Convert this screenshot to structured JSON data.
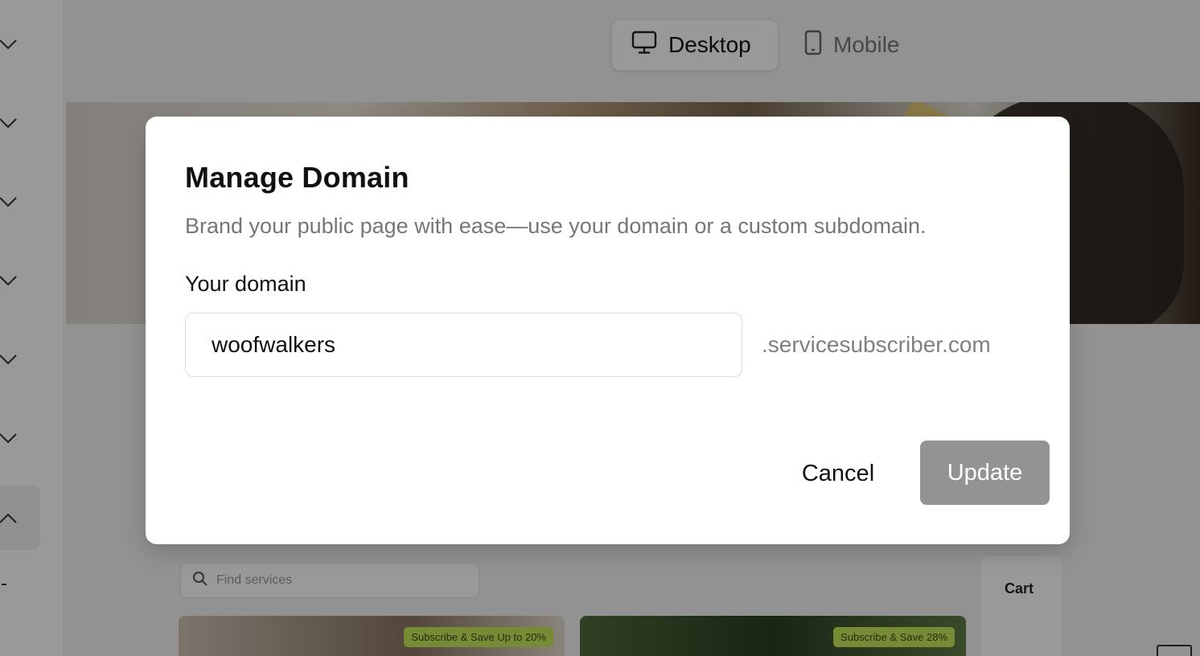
{
  "device_toggle": {
    "desktop_label": "Desktop",
    "mobile_label": "Mobile",
    "selected": "Desktop"
  },
  "sidebar": {
    "icons": [
      "chevron-down-icon",
      "chevron-down-icon",
      "chevron-down-icon",
      "chevron-down-icon",
      "chevron-down-icon",
      "chevron-down-icon",
      "chevron-up-icon"
    ]
  },
  "storefront": {
    "search_placeholder": "Find services",
    "cart_label": "Cart",
    "cards": [
      {
        "badge": "Subscribe & Save Up to 20%"
      },
      {
        "badge": "Subscribe & Save 28%"
      }
    ]
  },
  "modal": {
    "title": "Manage Domain",
    "description": "Brand your public page with ease—use your domain or a custom subdomain.",
    "field_label": "Your domain",
    "domain_value": "woofwalkers",
    "domain_suffix": ".servicesubscriber.com",
    "cancel_label": "Cancel",
    "update_label": "Update"
  },
  "colors": {
    "overlay": "#000000",
    "update_button_disabled": "#939393",
    "badge": "#c7e85a"
  }
}
